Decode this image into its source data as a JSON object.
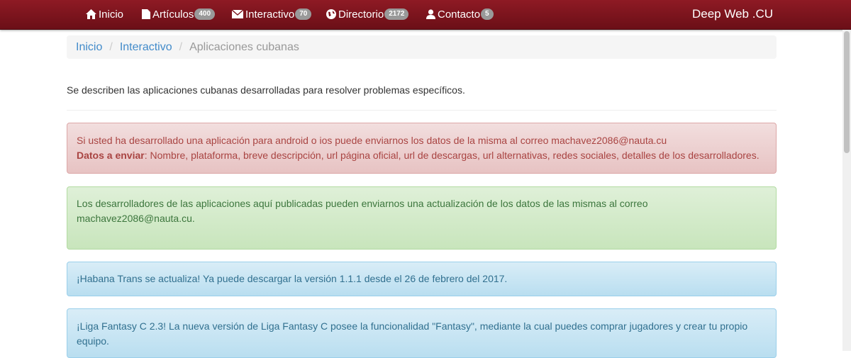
{
  "nav": {
    "items": [
      {
        "label": "Inicio",
        "icon": "home-icon",
        "badge": null
      },
      {
        "label": "Artículos",
        "icon": "file-icon",
        "badge": "400"
      },
      {
        "label": "Interactivo",
        "icon": "envelope-icon",
        "badge": "70"
      },
      {
        "label": "Directorio",
        "icon": "globe-icon",
        "badge": "2172"
      },
      {
        "label": "Contacto",
        "icon": "user-icon",
        "badge": "5"
      }
    ],
    "brand": "Deep Web .CU"
  },
  "breadcrumb": {
    "items": [
      "Inicio",
      "Interactivo"
    ],
    "active": "Aplicaciones cubanas"
  },
  "intro": "Se describen las aplicaciones cubanas desarrolladas para resolver problemas específicos.",
  "alerts": {
    "danger": {
      "line1": "Si usted ha desarrollado una aplicación para android o ios puede enviarnos los datos de la misma al correo machavez2086@nauta.cu",
      "label": "Datos a enviar",
      "text": ": Nombre, plataforma, breve descripción, url página oficial, url de descargas, url alternativas, redes sociales, detalles de los desarrolladores."
    },
    "success": {
      "text": "Los desarrolladores de las aplicaciones aquí publicadas pueden enviarnos una actualización de los datos de las mismas al correo machavez2086@nauta.cu."
    },
    "info1": {
      "text": "¡Habana Trans se actualiza! Ya puede descargar la versión 1.1.1 desde el 26 de febrero del 2017."
    },
    "info2": {
      "text": "¡Liga Fantasy C 2.3! La nueva versión de Liga Fantasy C posee la funcionalidad \"Fantasy\", mediante la cual puedes comprar jugadores y crear tu propio equipo."
    }
  },
  "colors": {
    "navbar": "#7a1019",
    "link": "#428bca",
    "danger_text": "#a94442",
    "success_text": "#3c763d",
    "info_text": "#31708f"
  }
}
